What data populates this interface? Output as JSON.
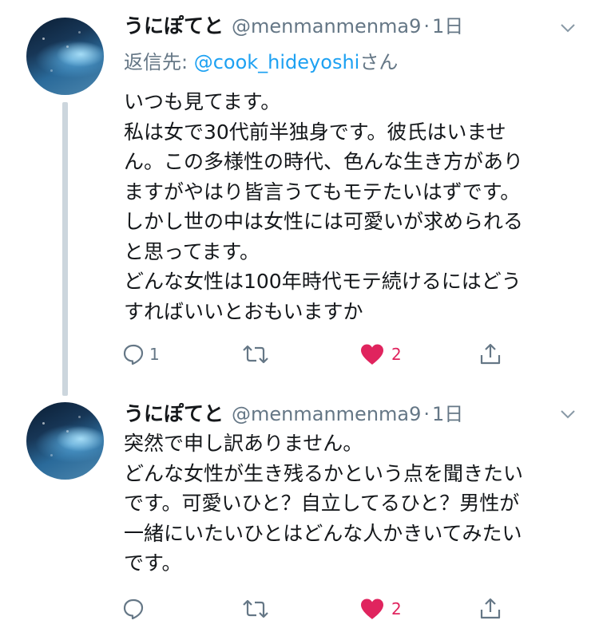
{
  "colors": {
    "text": "#14171a",
    "secondary": "#657786",
    "link": "#1da1f2",
    "like": "#e0245e",
    "thread_line": "#ccd6dd"
  },
  "tweets": [
    {
      "display_name": "うにぽてと",
      "handle": "@menmanmenma9",
      "separator": "·",
      "time": "1日",
      "reply_label": "返信先: ",
      "reply_mention": "@cook_hideyoshi",
      "reply_suffix": "さん",
      "lines": [
        "いつも見てます。",
        "私は女で30代前半独身です。彼氏はいませ",
        "ん。この多様性の時代、色んな生き方があり",
        "ますがやはり皆言うてもモテたいはずです。",
        "しかし世の中は女性には可愛いが求められる",
        "と思ってます。",
        "どんな女性は100年時代モテ続けるにはどう",
        "すればいいとおもいますか"
      ],
      "reply_count": "1",
      "retweet_count": "",
      "like_count": "2",
      "icons": [
        "reply-icon",
        "retweet-icon",
        "heart-icon",
        "share-icon",
        "chevron-down-icon"
      ]
    },
    {
      "display_name": "うにぽてと",
      "handle": "@menmanmenma9",
      "separator": "·",
      "time": "1日",
      "lines": [
        "突然で申し訳ありません。",
        "どんな女性が生き残るかという点を聞きたい",
        "です。可愛いひと？自立してるひと？男性が",
        "一緒にいたいひとはどんな人かきいてみたい",
        "です。"
      ],
      "reply_count": "",
      "retweet_count": "",
      "like_count": "2",
      "icons": [
        "reply-icon",
        "retweet-icon",
        "heart-icon",
        "share-icon",
        "chevron-down-icon"
      ]
    }
  ]
}
